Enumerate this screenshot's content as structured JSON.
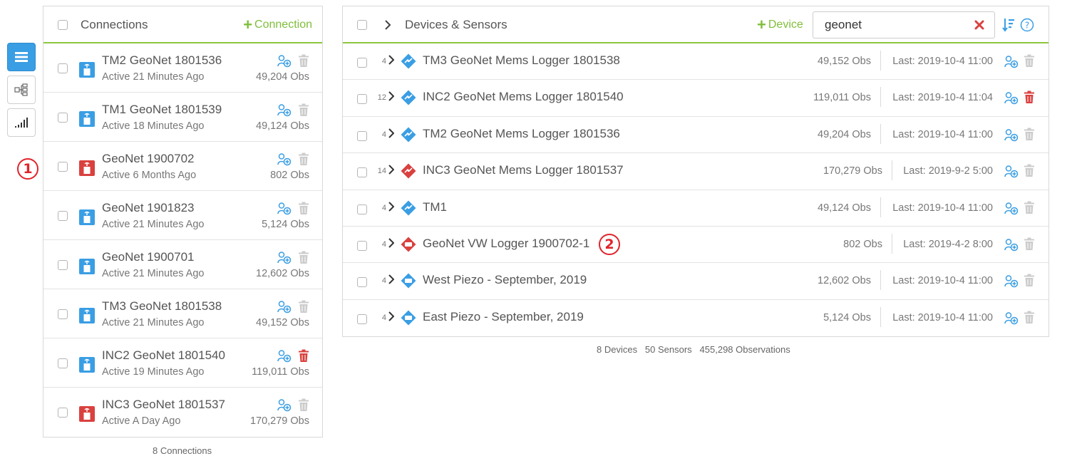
{
  "connections": {
    "title": "Connections",
    "add_label": "Connection",
    "rows": [
      {
        "name": "TM2 GeoNet 1801536",
        "active": "Active 21 Minutes Ago",
        "obs": "49,204 Obs",
        "status": "ok",
        "delete_active": false
      },
      {
        "name": "TM1 GeoNet 1801539",
        "active": "Active 18 Minutes Ago",
        "obs": "49,124 Obs",
        "status": "ok",
        "delete_active": false
      },
      {
        "name": "GeoNet 1900702",
        "active": "Active 6 Months Ago",
        "obs": "802 Obs",
        "status": "error",
        "delete_active": false
      },
      {
        "name": "GeoNet 1901823",
        "active": "Active 21 Minutes Ago",
        "obs": "5,124 Obs",
        "status": "ok",
        "delete_active": false
      },
      {
        "name": "GeoNet 1900701",
        "active": "Active 21 Minutes Ago",
        "obs": "12,602 Obs",
        "status": "ok",
        "delete_active": false
      },
      {
        "name": "TM3 GeoNet 1801538",
        "active": "Active 21 Minutes Ago",
        "obs": "49,152 Obs",
        "status": "ok",
        "delete_active": false
      },
      {
        "name": "INC2 GeoNet 1801540",
        "active": "Active 19 Minutes Ago",
        "obs": "119,011 Obs",
        "status": "ok",
        "delete_active": true
      },
      {
        "name": "INC3 GeoNet 1801537",
        "active": "Active A Day Ago",
        "obs": "170,279 Obs",
        "status": "error",
        "delete_active": false
      }
    ],
    "footer": "8 Connections"
  },
  "devices": {
    "title": "Devices & Sensors",
    "add_label": "Device",
    "search_value": "geonet",
    "rows": [
      {
        "count": "4",
        "name": "TM3 GeoNet Mems Logger 1801538",
        "obs": "49,152 Obs",
        "last": "Last: 2019-10-4 11:00",
        "kind": "mems",
        "status": "ok",
        "delete_active": false
      },
      {
        "count": "12",
        "name": "INC2 GeoNet Mems Logger 1801540",
        "obs": "119,011 Obs",
        "last": "Last: 2019-10-4 11:04",
        "kind": "mems",
        "status": "ok",
        "delete_active": true
      },
      {
        "count": "4",
        "name": "TM2 GeoNet Mems Logger 1801536",
        "obs": "49,204 Obs",
        "last": "Last: 2019-10-4 11:00",
        "kind": "mems",
        "status": "ok",
        "delete_active": false
      },
      {
        "count": "14",
        "name": "INC3 GeoNet Mems Logger 1801537",
        "obs": "170,279 Obs",
        "last": "Last: 2019-9-2 5:00",
        "kind": "mems",
        "status": "error",
        "delete_active": false
      },
      {
        "count": "4",
        "name": "TM1",
        "obs": "49,124 Obs",
        "last": "Last: 2019-10-4 11:00",
        "kind": "mems",
        "status": "ok",
        "delete_active": false
      },
      {
        "count": "4",
        "name": "GeoNet VW Logger 1900702-1",
        "obs": "802 Obs",
        "last": "Last: 2019-4-2 8:00",
        "kind": "vw",
        "status": "error",
        "delete_active": false
      },
      {
        "count": "4",
        "name": "West Piezo - September, 2019",
        "obs": "12,602 Obs",
        "last": "Last: 2019-10-4 11:00",
        "kind": "vw",
        "status": "ok",
        "delete_active": false
      },
      {
        "count": "4",
        "name": "East Piezo - September, 2019",
        "obs": "5,124 Obs",
        "last": "Last: 2019-10-4 11:00",
        "kind": "vw",
        "status": "ok",
        "delete_active": false
      }
    ],
    "footer": {
      "devices": "8 Devices",
      "sensors": "50 Sensors",
      "observations": "455,298 Observations"
    }
  },
  "markers": [
    "1",
    "2"
  ],
  "colors": {
    "accent_green": "#7fbe3a",
    "blue": "#3a9ee4",
    "red": "#d9413f",
    "grey_icon": "#cccccc"
  },
  "icons": {
    "toolbar": [
      "list-view-icon",
      "tree-view-icon",
      "signal-icon"
    ]
  }
}
